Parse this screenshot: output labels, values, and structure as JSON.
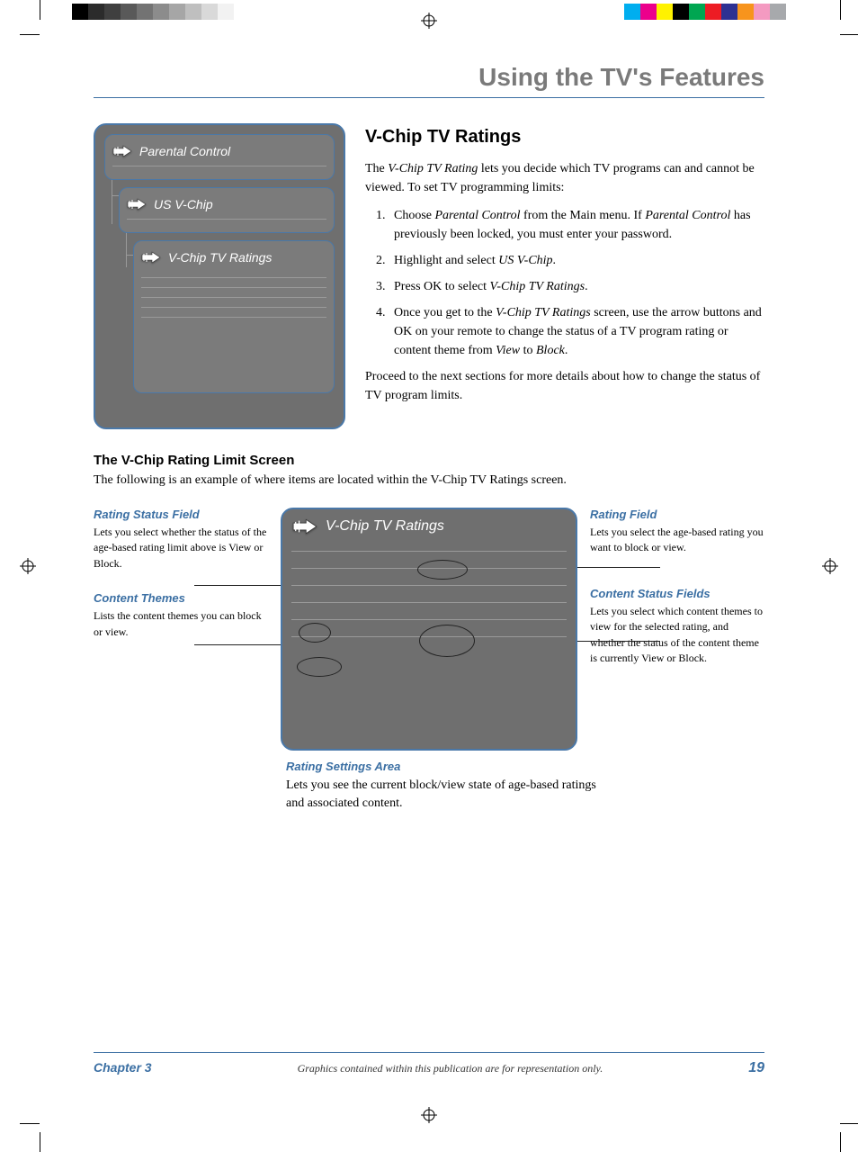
{
  "header": {
    "title": "Using the TV's Features"
  },
  "menu": {
    "items": [
      {
        "label": "Parental Control"
      },
      {
        "label": "US V-Chip"
      },
      {
        "label": "V-Chip TV Ratings"
      }
    ]
  },
  "main": {
    "heading": "V-Chip TV Ratings",
    "intro_pre": "The ",
    "intro_em": "V-Chip TV Rating",
    "intro_post": " lets you decide which TV programs can and cannot be viewed. To set TV programming limits:",
    "steps": [
      {
        "pre": "Choose ",
        "em1": "Parental Control",
        "mid": " from the Main menu. If ",
        "em2": "Parental Control",
        "post": " has previously been locked, you must enter your password."
      },
      {
        "pre": "Highlight and select ",
        "em1": "US V-Chip",
        "post": "."
      },
      {
        "pre": "Press OK to select ",
        "em1": "V-Chip TV Ratings",
        "post": "."
      },
      {
        "pre": "Once you get to the ",
        "em1": "V-Chip TV Ratings",
        "mid": " screen, use the arrow buttons and OK on your remote to change the status of a TV program rating or content theme from ",
        "em2": "View",
        "mid2": " to ",
        "em3": "Block",
        "post": "."
      }
    ],
    "proceed": "Proceed to the next sections for more details about how to change the status of TV program limits."
  },
  "limit": {
    "heading": "The V-Chip Rating Limit Screen",
    "intro": "The following is an example of where items are located within the V-Chip TV Ratings screen.",
    "panel_title": "V-Chip TV Ratings",
    "left": [
      {
        "title": "Rating Status Field",
        "body": "Lets you select whether the status of the age-based rating limit above is View or Block."
      },
      {
        "title": "Content Themes",
        "body": "Lists the content themes you can block or view."
      }
    ],
    "right": [
      {
        "title": "Rating Field",
        "body": "Lets you select the age-based rating you want to block or view."
      },
      {
        "title": "Content Status Fields",
        "body": "Lets you select which content themes to view for the selected rating, and whether the status of the content theme is currently View or Block."
      }
    ],
    "bottom": {
      "title": "Rating Settings Area",
      "body": "Lets you see the current block/view state of age-based ratings and associated content."
    }
  },
  "footer": {
    "chapter": "Chapter 3",
    "note": "Graphics contained within this publication are for representation only.",
    "page": "19"
  },
  "colorbars": {
    "left": [
      "#000000",
      "#2b2b2b",
      "#3f3f3f",
      "#595959",
      "#737373",
      "#8c8c8c",
      "#a6a6a6",
      "#bfbfbf",
      "#d9d9d9",
      "#f2f2f2",
      "#ffffff"
    ],
    "right": [
      "#00aeef",
      "#ec008c",
      "#fff200",
      "#000000",
      "#00a651",
      "#ed1c24",
      "#2e3192",
      "#f7941d",
      "#f49ac1",
      "#a7a9ac"
    ]
  }
}
